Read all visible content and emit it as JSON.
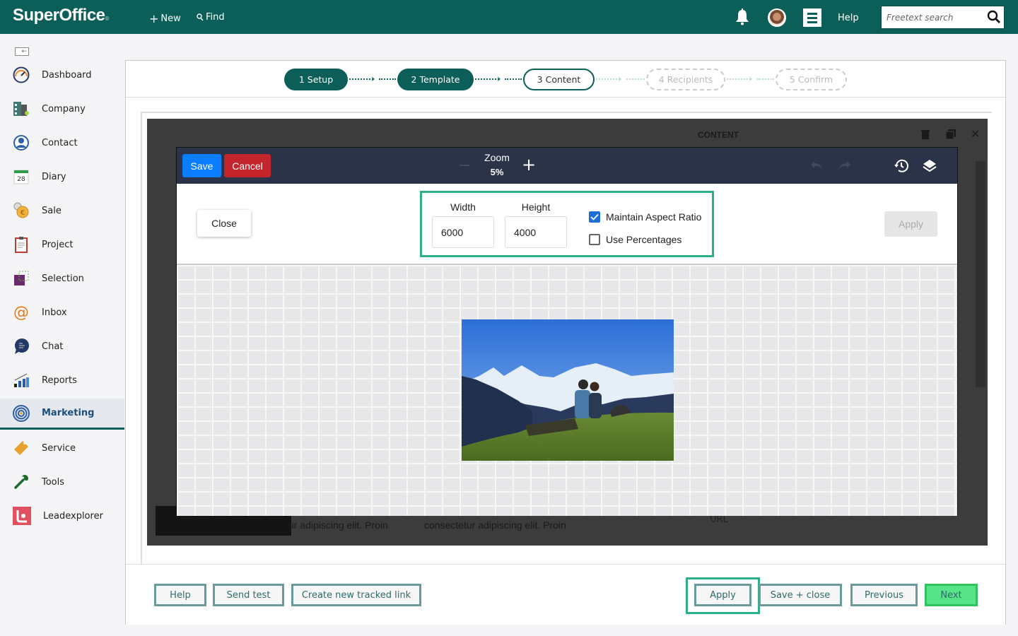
{
  "app": {
    "brand": "SuperOffice",
    "brand_mark": "®",
    "new_label": "New",
    "find_label": "Find",
    "help_label": "Help",
    "search_placeholder": "Freetext search",
    "accent_color": "#0c5f58"
  },
  "sidebar": {
    "items": [
      {
        "label": "Dashboard",
        "icon": "dashboard-gauge-icon"
      },
      {
        "label": "Company",
        "icon": "company-building-icon"
      },
      {
        "label": "Contact",
        "icon": "contact-person-icon"
      },
      {
        "label": "Diary",
        "icon": "diary-calendar-icon",
        "badge": "28"
      },
      {
        "label": "Sale",
        "icon": "sale-coin-icon"
      },
      {
        "label": "Project",
        "icon": "project-clipboard-icon"
      },
      {
        "label": "Selection",
        "icon": "selection-icon"
      },
      {
        "label": "Inbox",
        "icon": "inbox-at-icon"
      },
      {
        "label": "Chat",
        "icon": "chat-bubble-icon"
      },
      {
        "label": "Reports",
        "icon": "reports-chart-icon"
      },
      {
        "label": "Marketing",
        "icon": "marketing-target-icon",
        "active": true
      },
      {
        "label": "Service",
        "icon": "service-ticket-icon"
      },
      {
        "label": "Tools",
        "icon": "tools-wrench-icon"
      },
      {
        "label": "Leadexplorer",
        "icon": "leadexplorer-icon"
      }
    ]
  },
  "wizard": {
    "steps": [
      {
        "label": "1 Setup",
        "state": "done"
      },
      {
        "label": "2 Template",
        "state": "done"
      },
      {
        "label": "3 Content",
        "state": "current"
      },
      {
        "label": "4 Recipients",
        "state": "future"
      },
      {
        "label": "5 Confirm",
        "state": "future"
      }
    ]
  },
  "editor_background": {
    "panel_title": "CONTENT",
    "text_left": "ur adipiscing elit. Proin",
    "text_right": "consectetur adipiscing elit. Proin",
    "url_label": "URL"
  },
  "image_editor": {
    "save_label": "Save",
    "cancel_label": "Cancel",
    "zoom_label": "Zoom",
    "zoom_value": "5%",
    "close_label": "Close",
    "width_label": "Width",
    "width_value": "6000",
    "height_label": "Height",
    "height_value": "4000",
    "maintain_aspect_label": "Maintain Aspect Ratio",
    "maintain_aspect_checked": true,
    "use_percentages_label": "Use Percentages",
    "use_percentages_checked": false,
    "apply_label": "Apply",
    "image_alt": "Couple sitting on grassy hill facing snowy mountains"
  },
  "footer": {
    "help": "Help",
    "send_test": "Send test",
    "create_link": "Create new tracked link",
    "apply": "Apply",
    "save_close": "Save + close",
    "previous": "Previous",
    "next": "Next"
  }
}
